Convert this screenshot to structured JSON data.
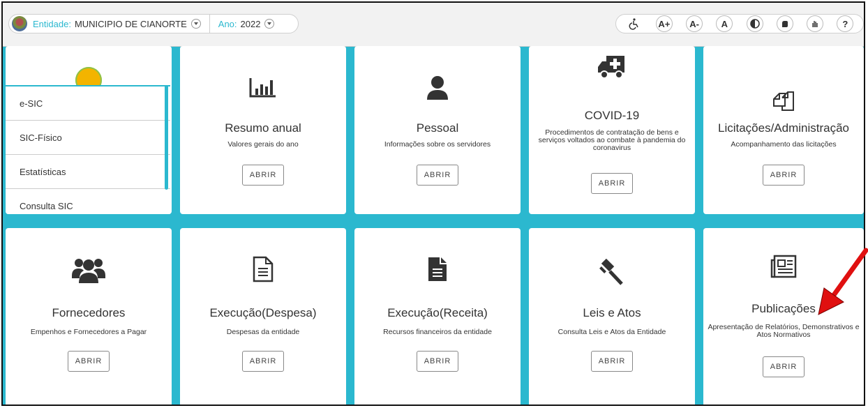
{
  "header": {
    "entity_label": "Entidade:",
    "entity_value": "MUNICIPIO DE CIANORTE",
    "year_label": "Ano:",
    "year_value": "2022",
    "accessibility": [
      "A+",
      "A-",
      "A",
      "?"
    ]
  },
  "sidebar": {
    "items": [
      "e-SIC",
      "SIC-Físico",
      "Estatísticas",
      "Consulta SIC"
    ]
  },
  "cards": [
    {
      "title": "Resumo anual",
      "desc": "Valores gerais do ano",
      "button": "ABRIR",
      "icon": "bar-chart-icon"
    },
    {
      "title": "Pessoal",
      "desc": "Informações sobre os servidores",
      "button": "ABRIR",
      "icon": "person-icon"
    },
    {
      "title": "COVID-19",
      "desc": "Procedimentos de contratação de bens e serviços voltados ao combate à pandemia do coronavirus",
      "button": "ABRIR",
      "icon": "ambulance-icon"
    },
    {
      "title": "Licitações/Administração",
      "desc": "Acompanhamento das licitações",
      "button": "ABRIR",
      "icon": "copy-icon"
    },
    {
      "title": "Fornecedores",
      "desc": "Empenhos e Fornecedores a Pagar",
      "button": "ABRIR",
      "icon": "users-icon"
    },
    {
      "title": "Execução(Despesa)",
      "desc": "Despesas da entidade",
      "button": "ABRIR",
      "icon": "document-outline-icon"
    },
    {
      "title": "Execução(Receita)",
      "desc": "Recursos financeiros da entidade",
      "button": "ABRIR",
      "icon": "document-filled-icon"
    },
    {
      "title": "Leis e Atos",
      "desc": "Consulta Leis e Atos da Entidade",
      "button": "ABRIR",
      "icon": "gavel-icon"
    },
    {
      "title": "Publicações",
      "desc": "Apresentação de Relatórios, Demonstrativos e Atos Normativos",
      "button": "ABRIR",
      "icon": "newspaper-icon"
    }
  ],
  "colors": {
    "accent": "#2bb8cf",
    "arrow": "#e01010"
  }
}
